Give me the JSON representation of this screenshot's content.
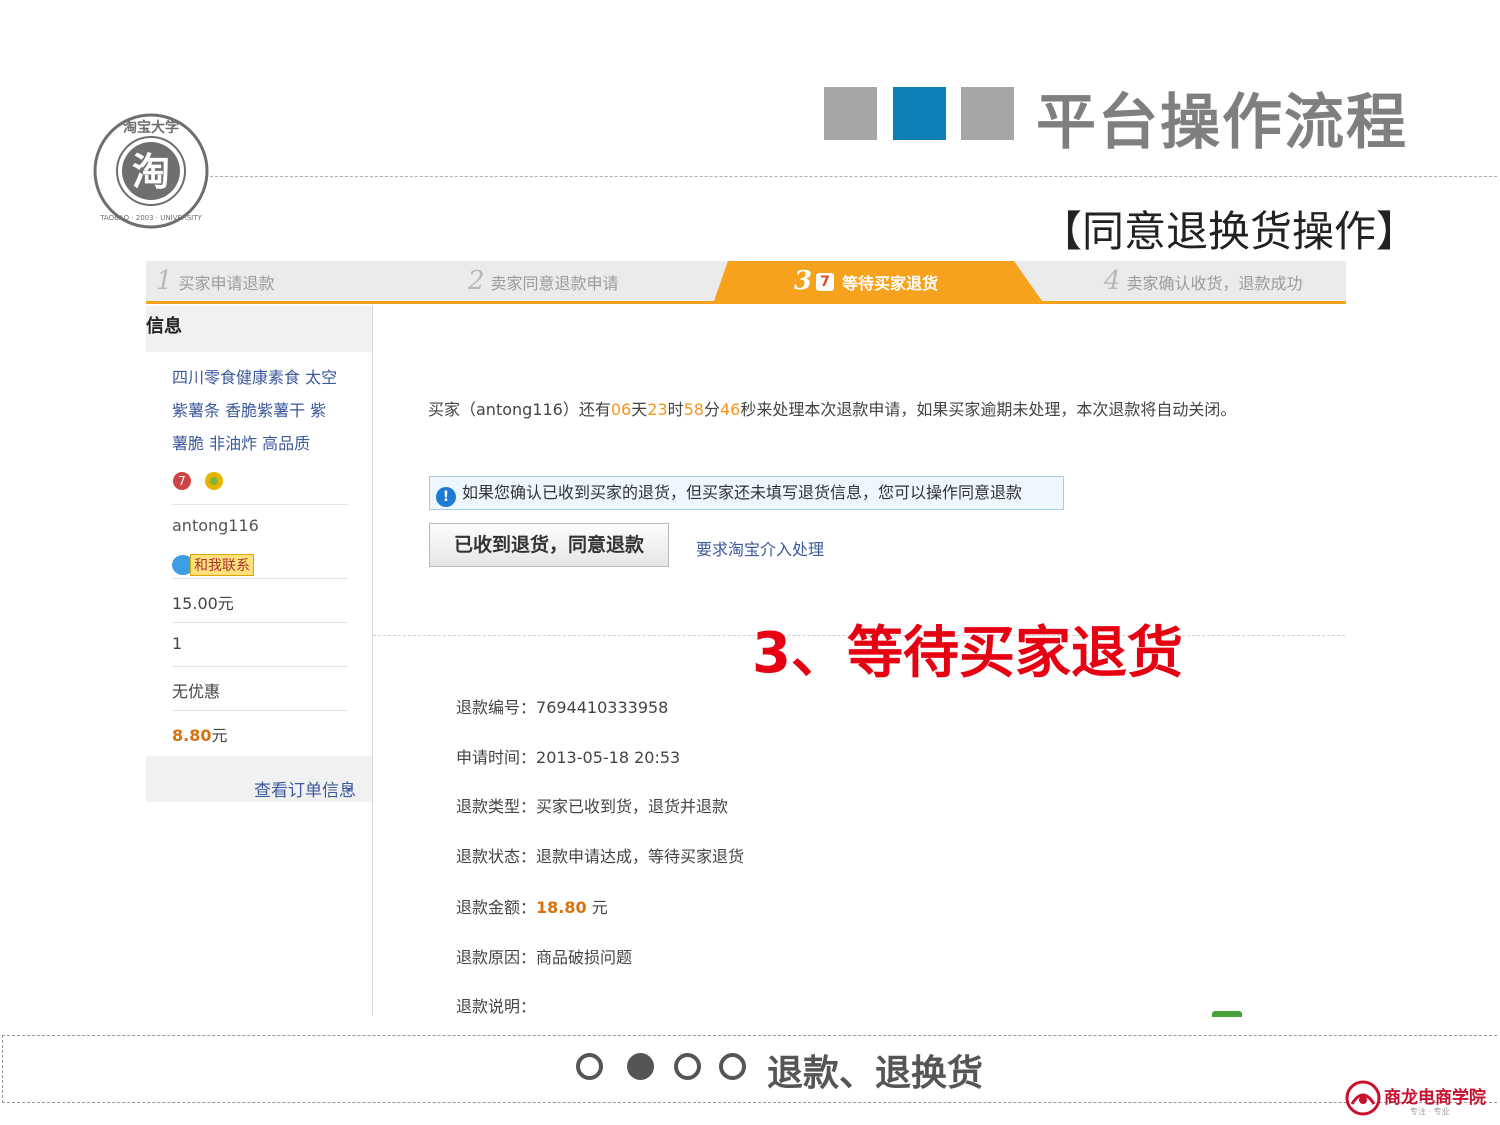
{
  "header": {
    "title": "平台操作流程",
    "subtitle": "【同意退换货操作】",
    "square_colors": [
      "#a6a6a6",
      "#0f7fb8",
      "#a6a6a6"
    ],
    "seal_text": {
      "center": "淘",
      "top": "淘宝大学",
      "bottom": "TAOBAO · 2003 · UNIVERSITY"
    }
  },
  "steps": [
    {
      "num": "1",
      "label": "买家申请退款"
    },
    {
      "num": "2",
      "label": "卖家同意退款申请"
    },
    {
      "num": "3",
      "label": "等待买家退货",
      "active": true
    },
    {
      "num": "4",
      "label": "卖家确认收货，退款成功"
    }
  ],
  "sidebar": {
    "heading": "信息",
    "product_lines": [
      "四川零食健康素食 太空",
      "紫薯条 香脆紫薯干 紫",
      "薯脆 非油炸 高品质"
    ],
    "buyer": "antong116",
    "contact_label": "和我联系",
    "price": "15.00元",
    "quantity": "1",
    "discount": "无优惠",
    "total_value": "8.80",
    "total_unit": "元",
    "view_order": "查看订单信息"
  },
  "main": {
    "notice": {
      "prefix": "买家（antong116）还有",
      "days": "06",
      "days_unit": "天",
      "hours": "23",
      "hours_unit": "时",
      "minutes": "58",
      "minutes_unit": "分",
      "seconds": "46",
      "suffix": "秒来处理本次退款申请，如果买家逾期未处理，本次退款将自动关闭。"
    },
    "info_box": "如果您确认已收到买家的退货，但买家还未填写退货信息，您可以操作同意退款",
    "agree_button": "已收到退货，同意退款",
    "intervene_link": "要求淘宝介入处理",
    "callout": "3、等待买家退货",
    "details": [
      {
        "label": "退款编号：",
        "value": "7694410333958"
      },
      {
        "label": "申请时间：",
        "value": "2013-05-18 20:53"
      },
      {
        "label": "退款类型：",
        "value": "买家已收到货，退货并退款"
      },
      {
        "label": "退款状态：",
        "value": "退款申请达成，等待买家退货"
      },
      {
        "label": "退款金额：",
        "value": "18.80",
        "unit": "元",
        "highlight": true
      },
      {
        "label": "退款原因：",
        "value": "商品破损问题"
      },
      {
        "label": "退款说明：",
        "value": ""
      }
    ]
  },
  "footer": {
    "title": "退款、退换货",
    "progress_dots": [
      false,
      true,
      false,
      false
    ],
    "logo_text": "商龙电商学院",
    "logo_sub": "专注 · 专业"
  },
  "colors": {
    "accent_orange": "#f7a21c",
    "highlight_red": "#e60012",
    "link_blue": "#3d5a9c"
  }
}
